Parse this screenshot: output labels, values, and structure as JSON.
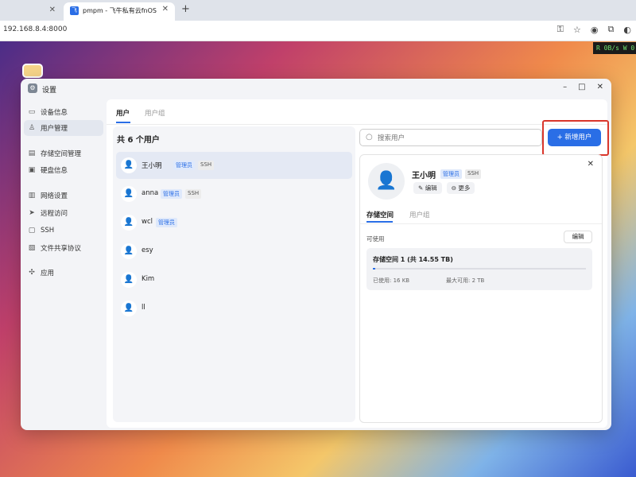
{
  "browser": {
    "tab_title": "pmpm - 飞牛私有云fnOS",
    "tab_favicon": "fnOS",
    "url": "192.168.8.4:8000",
    "net_speed": "R 0B/s W 0"
  },
  "window": {
    "title": "设置"
  },
  "sidebar": {
    "items": [
      {
        "label": "设备信息",
        "icon": "monitor-icon"
      },
      {
        "label": "用户管理",
        "icon": "user-icon"
      },
      {
        "label": "存储空间管理",
        "icon": "storage-icon"
      },
      {
        "label": "硬盘信息",
        "icon": "disk-icon"
      },
      {
        "label": "网络设置",
        "icon": "network-icon"
      },
      {
        "label": "远程访问",
        "icon": "send-icon"
      },
      {
        "label": "SSH",
        "icon": "terminal-icon"
      },
      {
        "label": "文件共享协议",
        "icon": "file-share-icon"
      },
      {
        "label": "应用",
        "icon": "apps-icon"
      }
    ]
  },
  "main": {
    "tabs": [
      "用户",
      "用户组"
    ],
    "user_count_label": "共 6 个用户",
    "search_placeholder": "搜索用户",
    "add_user_label": "+ 新增用户",
    "users": [
      {
        "name": "王小明",
        "badges": [
          "管理员",
          "SSH"
        ]
      },
      {
        "name": "anna",
        "badges": [
          "管理员",
          "SSH"
        ]
      },
      {
        "name": "wcl",
        "badges": [
          "管理员"
        ]
      },
      {
        "name": "esy",
        "badges": []
      },
      {
        "name": "Kim",
        "badges": []
      },
      {
        "name": "ll",
        "badges": []
      }
    ]
  },
  "detail": {
    "name": "王小明",
    "badges": [
      "管理员",
      "SSH"
    ],
    "edit_label": "编辑",
    "more_label": "更多",
    "tabs": [
      "存储空间",
      "用户组"
    ],
    "available_label": "可使用",
    "edit_button": "编辑",
    "storage": {
      "title": "存储空间 1 (共 14.55 TB)",
      "used": "已使用:  16 KB",
      "max": "最大可用:  2 TB",
      "used_fraction": 0.01
    }
  },
  "colors": {
    "accent": "#2a6ee6",
    "highlight_frame": "#d9362b"
  }
}
